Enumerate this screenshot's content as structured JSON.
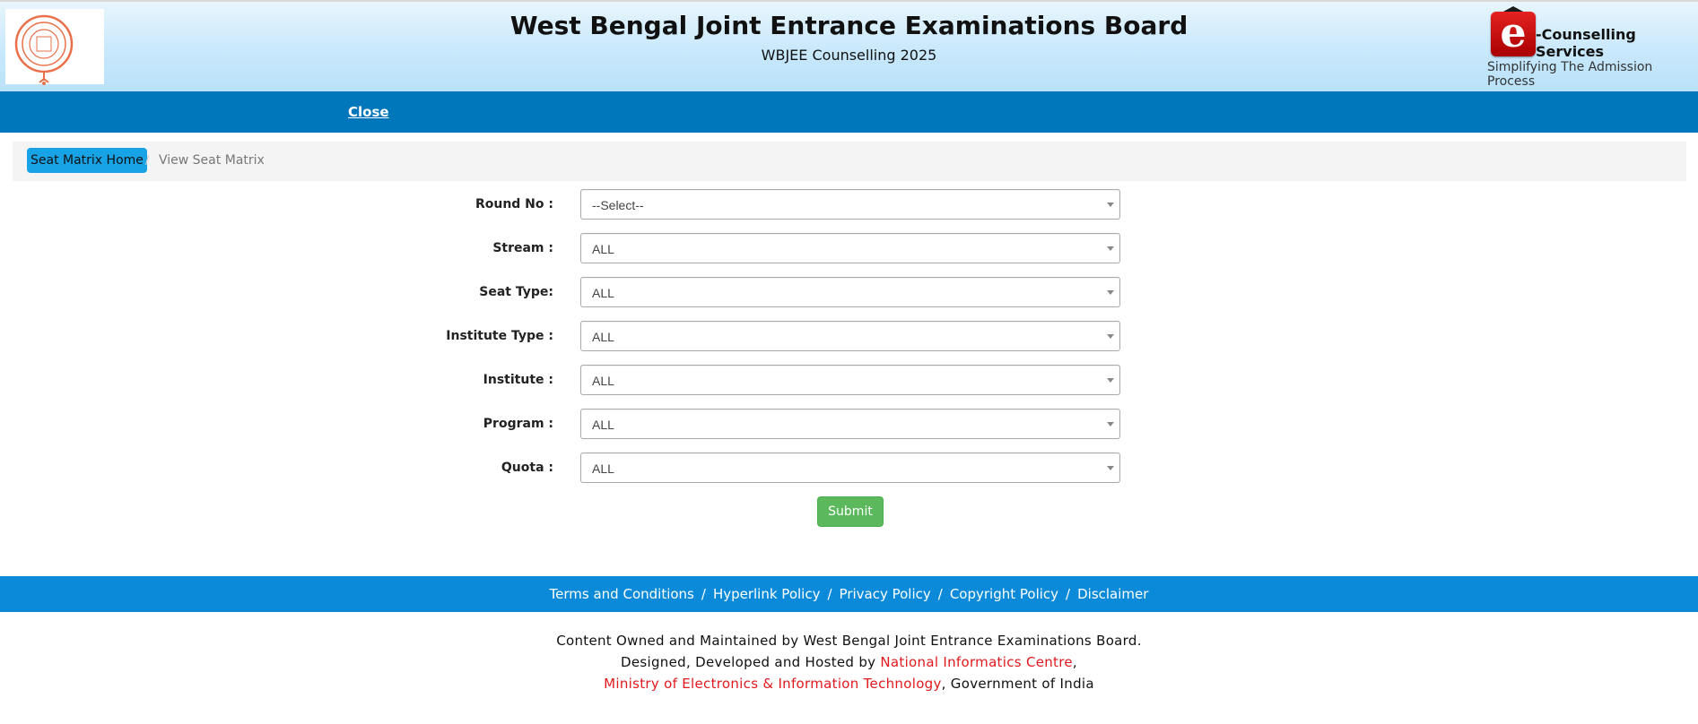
{
  "header": {
    "title": "West Bengal Joint Entrance Examinations Board",
    "subtitle": "WBJEE Counselling 2025",
    "ecounselling_text": "-Counselling Services",
    "ecounselling_letter": "e",
    "tagline": "Simplifying The Admission Process"
  },
  "nav": {
    "close_label": "Close"
  },
  "breadcrumb": {
    "home": "Seat Matrix Home",
    "separator": "/",
    "current": "View Seat Matrix"
  },
  "form": {
    "fields": [
      {
        "label": "Round No :",
        "value": "--Select--"
      },
      {
        "label": "Stream :",
        "value": "ALL"
      },
      {
        "label": "Seat Type:",
        "value": "ALL"
      },
      {
        "label": "Institute Type :",
        "value": "ALL"
      },
      {
        "label": "Institute :",
        "value": "ALL"
      },
      {
        "label": "Program :",
        "value": "ALL"
      },
      {
        "label": "Quota :",
        "value": "ALL"
      }
    ],
    "submit_label": "Submit"
  },
  "footer": {
    "links": [
      "Terms and Conditions",
      "Hyperlink Policy",
      "Privacy Policy",
      "Copyright Policy",
      "Disclaimer"
    ],
    "separator": "/",
    "line1": "Content Owned and Maintained by West Bengal Joint Entrance Examinations Board.",
    "line2_prefix": "Designed, Developed and Hosted by ",
    "line2_link": "National Informatics Centre",
    "line2_suffix": ",",
    "line3_link": "Ministry of Electronics & Information Technology",
    "line3_suffix": ", Government of India"
  },
  "colors": {
    "navbar": "#0077bb",
    "breadcrumb_home": "#17a3e6",
    "submit": "#5cb85c",
    "footer_bar": "#0a8ad8",
    "link_red": "#e0191e"
  }
}
